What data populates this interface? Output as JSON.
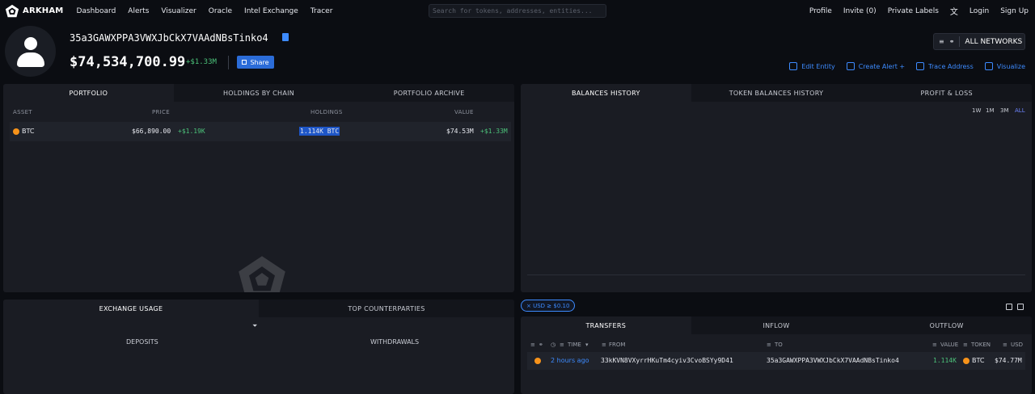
{
  "nav": {
    "brand": "ARKHAM",
    "links": [
      "Dashboard",
      "Alerts",
      "Visualizer",
      "Oracle",
      "Intel Exchange",
      "Tracer"
    ],
    "search_placeholder": "Search for tokens, addresses, entities...",
    "right_links": [
      "Profile",
      "Invite (0)",
      "Private Labels",
      "Login",
      "Sign Up"
    ]
  },
  "entity": {
    "address": "35a3GAWXPPA3VWXJbCkX7VAAdNBsTinko4",
    "balance": "$74,534,700.99",
    "balance_change": "+$1.33M",
    "share_label": "Share",
    "networks_label": "ALL NETWORKS",
    "actions": [
      "Edit Entity",
      "Create Alert +",
      "Trace Address",
      "Visualize"
    ]
  },
  "portfolio": {
    "tabs": [
      "PORTFOLIO",
      "HOLDINGS BY CHAIN",
      "PORTFOLIO ARCHIVE"
    ],
    "columns": [
      "ASSET",
      "PRICE",
      "HOLDINGS",
      "VALUE"
    ],
    "rows": [
      {
        "asset": "BTC",
        "price": "$66,890.00",
        "price_change": "+$1.19K",
        "holdings": "1.114K BTC",
        "value": "$74.53M",
        "value_change": "+$1.33M"
      }
    ]
  },
  "history": {
    "tabs": [
      "BALANCES HISTORY",
      "TOKEN BALANCES HISTORY",
      "PROFIT & LOSS"
    ],
    "ranges": [
      "1W",
      "1M",
      "3M",
      "ALL"
    ],
    "selected_range": "ALL"
  },
  "exchange": {
    "tabs": [
      "EXCHANGE USAGE",
      "TOP COUNTERPARTIES"
    ],
    "deposits_label": "DEPOSITS",
    "withdrawals_label": "WITHDRAWALS"
  },
  "transfers": {
    "filter_chip": "× USD ≥ $0.10",
    "tabs": [
      "TRANSFERS",
      "INFLOW",
      "OUTFLOW"
    ],
    "columns": {
      "time": "TIME",
      "from": "FROM",
      "to": "TO",
      "value": "VALUE",
      "token": "TOKEN",
      "usd": "USD"
    },
    "rows": [
      {
        "time": "2 hours ago",
        "from": "33kKVN8VXyrrHKuTm4cyiv3CvoBSYy9D41",
        "to": "35a3GAWXPPA3VWXJbCkX7VAAdNBsTinko4",
        "value": "1.114K",
        "token": "BTC",
        "usd": "$74.77M"
      }
    ]
  },
  "colors": {
    "accent": "#3d8bff",
    "positive": "#4cc27a",
    "btc": "#f7931a",
    "background": "#0b0d12",
    "panel": "#1a1c23"
  }
}
